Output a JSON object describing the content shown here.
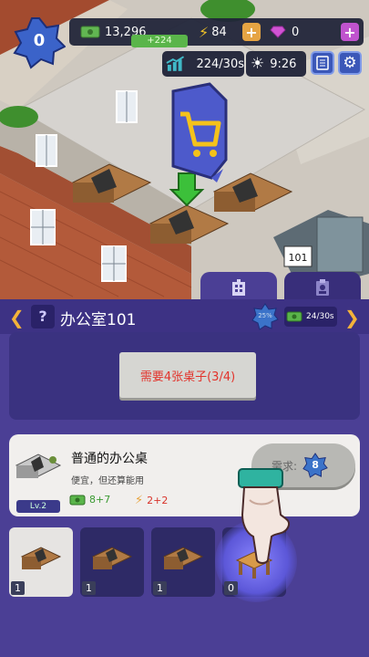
{
  "hud": {
    "level": "0",
    "cash": "13,296",
    "cash_gain": "+224",
    "energy": "84",
    "gems": "0",
    "income_rate": "224/30s",
    "time": "9:26"
  },
  "room": {
    "name": "办公室101",
    "door_sign": "101",
    "star_label": "25%",
    "income": "24/30s",
    "requirement": "需要4张桌子(3/4)"
  },
  "item": {
    "title": "普通的办公桌",
    "description": "便宜，但还算能用",
    "level": "Lv.2",
    "stat_cash": "8+7",
    "stat_energy": "2+2",
    "need_label": "需求:",
    "need_value": "8"
  },
  "slots": [
    {
      "count": "1"
    },
    {
      "count": "1"
    },
    {
      "count": "1"
    },
    {
      "count": "0"
    }
  ],
  "colors": {
    "panel": "#4b3f95",
    "accent_gold": "#f4b33a",
    "cash_green": "#5ab54a",
    "gem_pink": "#d24bd6",
    "requirement_red": "#e2332b"
  }
}
